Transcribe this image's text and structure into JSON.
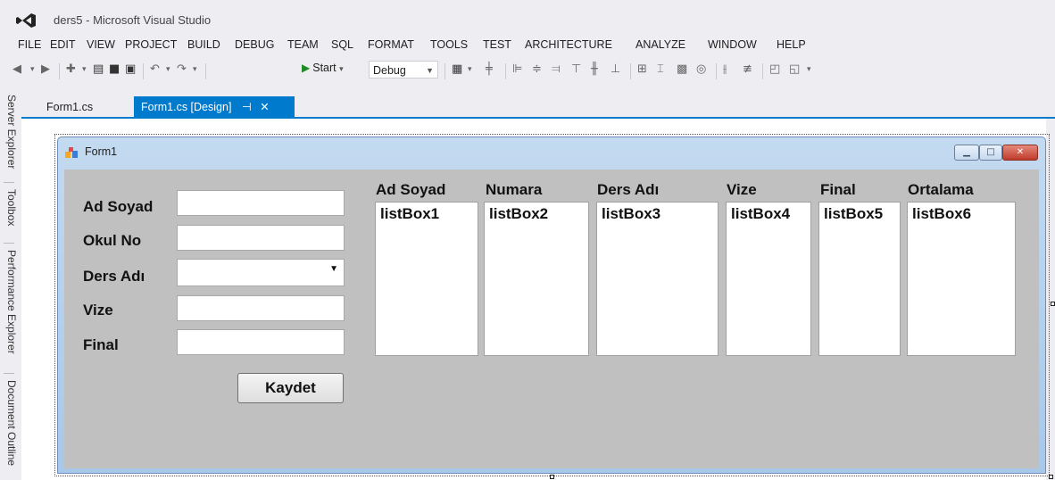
{
  "window": {
    "title": "ders5 - Microsoft Visual Studio"
  },
  "menu": [
    "FILE",
    "EDIT",
    "VIEW",
    "PROJECT",
    "BUILD",
    "DEBUG",
    "TEAM",
    "SQL",
    "FORMAT",
    "TOOLS",
    "TEST",
    "ARCHITECTURE",
    "ANALYZE",
    "WINDOW",
    "HELP"
  ],
  "toolbar": {
    "start_label": "Start",
    "config_value": "Debug"
  },
  "side_tabs": [
    "Server Explorer",
    "Toolbox",
    "Performance Explorer",
    "Document Outline"
  ],
  "doc_tabs": [
    {
      "label": "Form1.cs",
      "active": false
    },
    {
      "label": "Form1.cs [Design]",
      "active": true,
      "pin": "⊣",
      "close": "✕"
    }
  ],
  "form": {
    "title": "Form1",
    "labels": {
      "ad_soyad": "Ad Soyad",
      "okul_no": "Okul No",
      "ders_adi": "Ders Adı",
      "vize": "Vize",
      "final": "Final"
    },
    "inputs": {
      "ad_soyad": "",
      "okul_no": "",
      "ders_adi": "",
      "vize": "",
      "final": ""
    },
    "save_button": "Kaydet",
    "columns": [
      {
        "header": "Ad Soyad",
        "listbox": "listBox1"
      },
      {
        "header": "Numara",
        "listbox": "listBox2"
      },
      {
        "header": "Ders Adı",
        "listbox": "listBox3"
      },
      {
        "header": "Vize",
        "listbox": "listBox4"
      },
      {
        "header": "Final",
        "listbox": "listBox5"
      },
      {
        "header": "Ortalama",
        "listbox": "listBox6"
      }
    ]
  },
  "colors": {
    "accent": "#007acc",
    "client_bg": "#c0c0c0",
    "play_green": "#1f8b24"
  }
}
